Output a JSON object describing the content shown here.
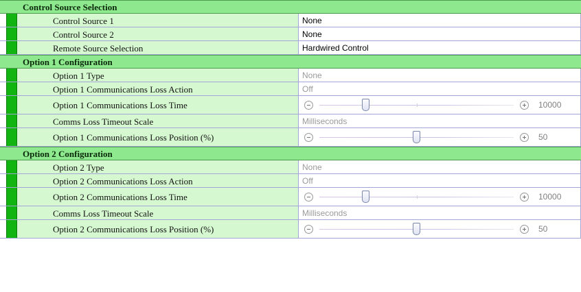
{
  "sections": [
    {
      "title": "Control Source Selection",
      "rows": [
        {
          "name": "Control Source 1",
          "value": "None",
          "enabled": true
        },
        {
          "name": "Control Source 2",
          "value": "None",
          "enabled": true
        },
        {
          "name": "Remote Source Selection",
          "value": "Hardwired Control",
          "enabled": true
        }
      ]
    },
    {
      "title": "Option 1 Configuration",
      "rows": [
        {
          "name": "Option 1 Type",
          "value": "None",
          "enabled": false
        },
        {
          "name": "Option 1 Communications Loss Action",
          "value": "Off",
          "enabled": false
        },
        {
          "name": "Option 1 Communications Loss Time",
          "slider": true,
          "value": "10000",
          "fraction": 0.24
        },
        {
          "name": "Comms Loss Timeout Scale",
          "value": "Milliseconds",
          "enabled": false
        },
        {
          "name": "Option 1 Communications Loss Position (%)",
          "slider": true,
          "value": "50",
          "fraction": 0.5
        }
      ]
    },
    {
      "title": "Option 2 Configuration",
      "rows": [
        {
          "name": "Option 2 Type",
          "value": "None",
          "enabled": false
        },
        {
          "name": "Option 2 Communications Loss Action",
          "value": "Off",
          "enabled": false
        },
        {
          "name": "Option 2 Communications Loss Time",
          "slider": true,
          "value": "10000",
          "fraction": 0.24
        },
        {
          "name": "Comms Loss Timeout Scale",
          "value": "Milliseconds",
          "enabled": false
        },
        {
          "name": "Option 2 Communications Loss Position (%)",
          "slider": true,
          "value": "50",
          "fraction": 0.5
        }
      ]
    }
  ]
}
